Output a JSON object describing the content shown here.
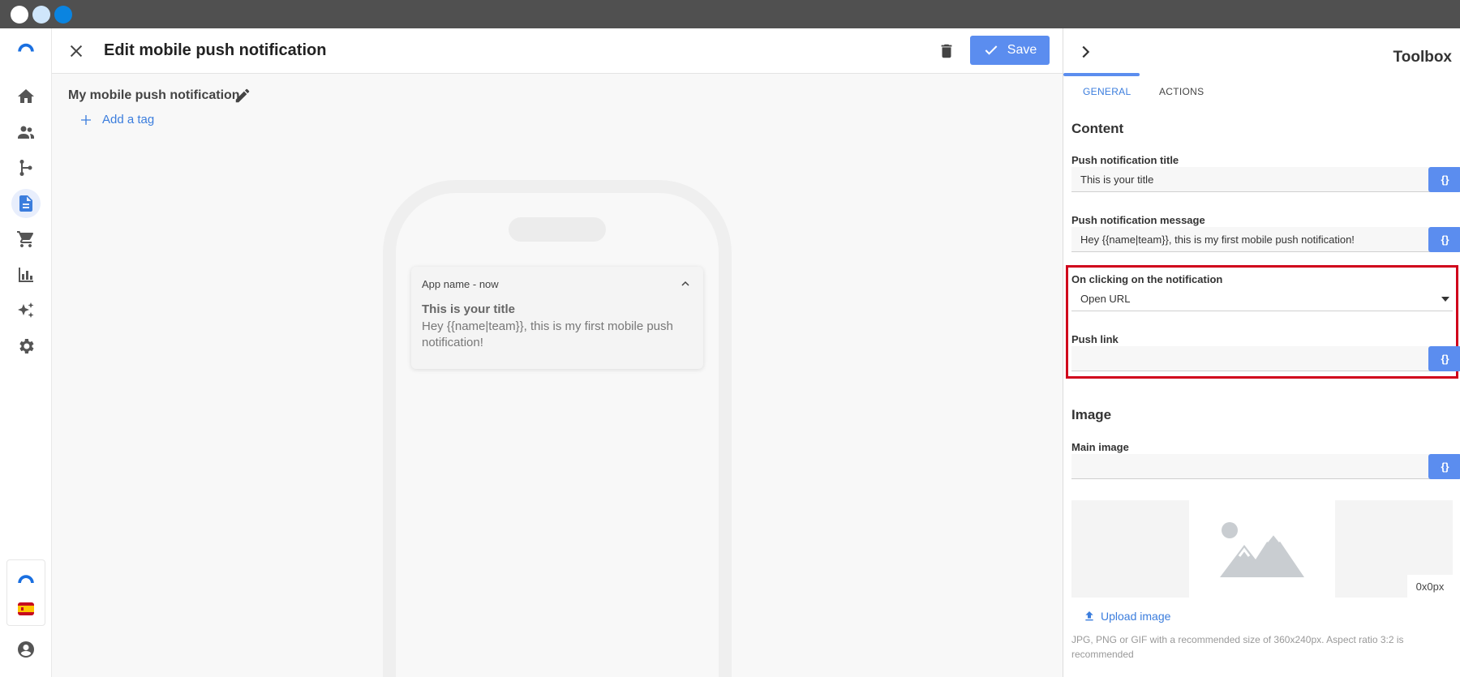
{
  "colors": {
    "accent": "#5b8def",
    "link": "#3b7ddd",
    "highlight": "#d0021b",
    "titlebar": "#505050"
  },
  "window": {
    "dots": [
      "#ffffff",
      "#cfe6fb",
      "#0a84e0"
    ]
  },
  "sidebar": {
    "items": [
      {
        "icon": "home-icon"
      },
      {
        "icon": "people-icon"
      },
      {
        "icon": "flow-icon"
      },
      {
        "icon": "document-icon",
        "active": true
      },
      {
        "icon": "cart-icon"
      },
      {
        "icon": "bar-chart-icon"
      },
      {
        "icon": "sparkle-icon"
      },
      {
        "icon": "gear-icon"
      }
    ],
    "bottom": [
      {
        "icon": "brand-logo-icon"
      },
      {
        "icon": "spain-flag-icon"
      },
      {
        "icon": "account-icon"
      }
    ]
  },
  "header": {
    "title": "Edit mobile push notification",
    "save_label": "Save"
  },
  "editor": {
    "name": "My mobile push notification",
    "add_tag": "Add a tag"
  },
  "preview": {
    "app_line": "App name - now",
    "title": "This is your title",
    "message": "Hey {{name|team}}, this is my first mobile push notification!"
  },
  "toolbox": {
    "title": "Toolbox",
    "tabs": [
      "GENERAL",
      "ACTIONS"
    ],
    "content_heading": "Content",
    "title_label": "Push notification title",
    "title_value": "This is your title",
    "message_label": "Push notification message",
    "message_value": "Hey {{name|team}}, this is my first mobile push notification!",
    "click_label": "On clicking on the notification",
    "click_value": "Open URL",
    "link_label": "Push link",
    "link_value": "",
    "var_button": "{}",
    "image_heading": "Image",
    "main_image_label": "Main image",
    "main_image_value": "",
    "dims": "0x0px",
    "upload_label": "Upload image",
    "help_text": "JPG, PNG or GIF with a recommended size of 360x240px. Aspect ratio 3:2 is recommended"
  }
}
